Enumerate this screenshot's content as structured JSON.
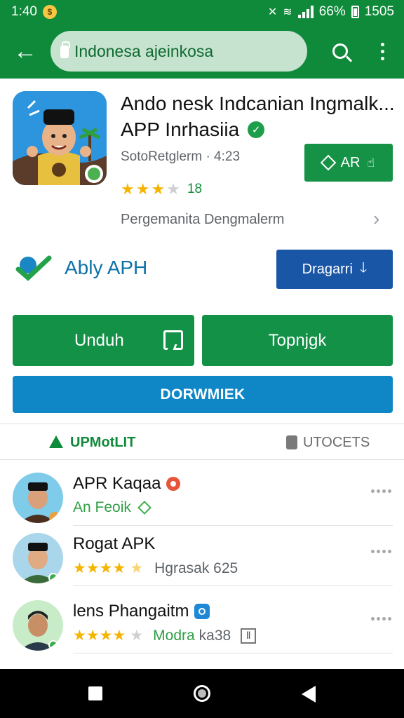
{
  "status": {
    "time": "1:40",
    "battery": "66%",
    "clock_right": "1505"
  },
  "search": {
    "text": "Indonesa ajeinkosa"
  },
  "app": {
    "title_line1": "Ando nesk Indcanian Ingmalk...",
    "title_line2": "APP Inrhasiia",
    "developer": "SotoRetglerm · 4:23",
    "rating_count": "18",
    "rating_stars": 3,
    "ar_button": "AR",
    "permissions": "Pergemanita Dengmalerm"
  },
  "ably": {
    "label": "Ably APH",
    "button": "Dragarri"
  },
  "actions": {
    "unduh": "Unduh",
    "topnjgk": "Topnjgk",
    "dorwmiek": "DORWMIEK"
  },
  "tabs": [
    {
      "label": "UPMotLIT"
    },
    {
      "label": "UTOCETS"
    }
  ],
  "reviews": [
    {
      "name": "APR Kaqaa",
      "sub": "An Feoik",
      "stars": 0
    },
    {
      "name": "Rogat APK",
      "sub": "Hgrasak 625",
      "stars": 4
    },
    {
      "name": "lens Phangaitm",
      "sub_green": "Modra",
      "sub": "ka38",
      "stars": 4
    }
  ],
  "colors": {
    "primary_green": "#0f8a3a",
    "blue_button": "#1a56a6",
    "light_blue": "#0f86c6",
    "star": "#f4b400"
  }
}
